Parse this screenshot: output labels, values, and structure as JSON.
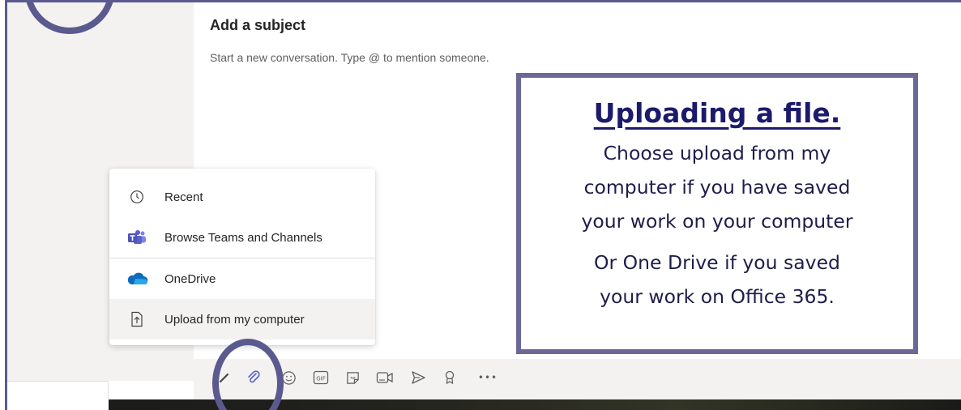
{
  "compose": {
    "subject_placeholder": "Add a subject",
    "message_placeholder": "Start a new conversation. Type @ to mention someone."
  },
  "attach_menu": {
    "items": [
      {
        "label": "Recent",
        "icon": "clock-icon"
      },
      {
        "label": "Browse Teams and Channels",
        "icon": "teams-icon"
      },
      {
        "label": "OneDrive",
        "icon": "onedrive-cloud-icon"
      },
      {
        "label": "Upload from my computer",
        "icon": "upload-file-icon"
      }
    ]
  },
  "toolbar": {
    "icons": [
      "format-icon",
      "attach-icon",
      "emoji-icon",
      "gif-icon",
      "sticker-icon",
      "meet-now-icon",
      "schedule-send-icon",
      "praise-icon",
      "more-options-icon"
    ],
    "gif_label": "GIF",
    "more_label": "•••"
  },
  "callout": {
    "title": "Uploading a file.",
    "paragraph1": [
      "Choose upload from my",
      "computer if you have saved",
      "your work on your computer"
    ],
    "paragraph2": [
      "Or One Drive if you saved",
      "your work on Office 365."
    ]
  },
  "colors": {
    "frame": "#5b5a8e",
    "callout_border": "#6b6897",
    "callout_title": "#1c1a6b",
    "teams_purple": "#5b5fc7",
    "onedrive_blue": "#0f6cbd"
  }
}
